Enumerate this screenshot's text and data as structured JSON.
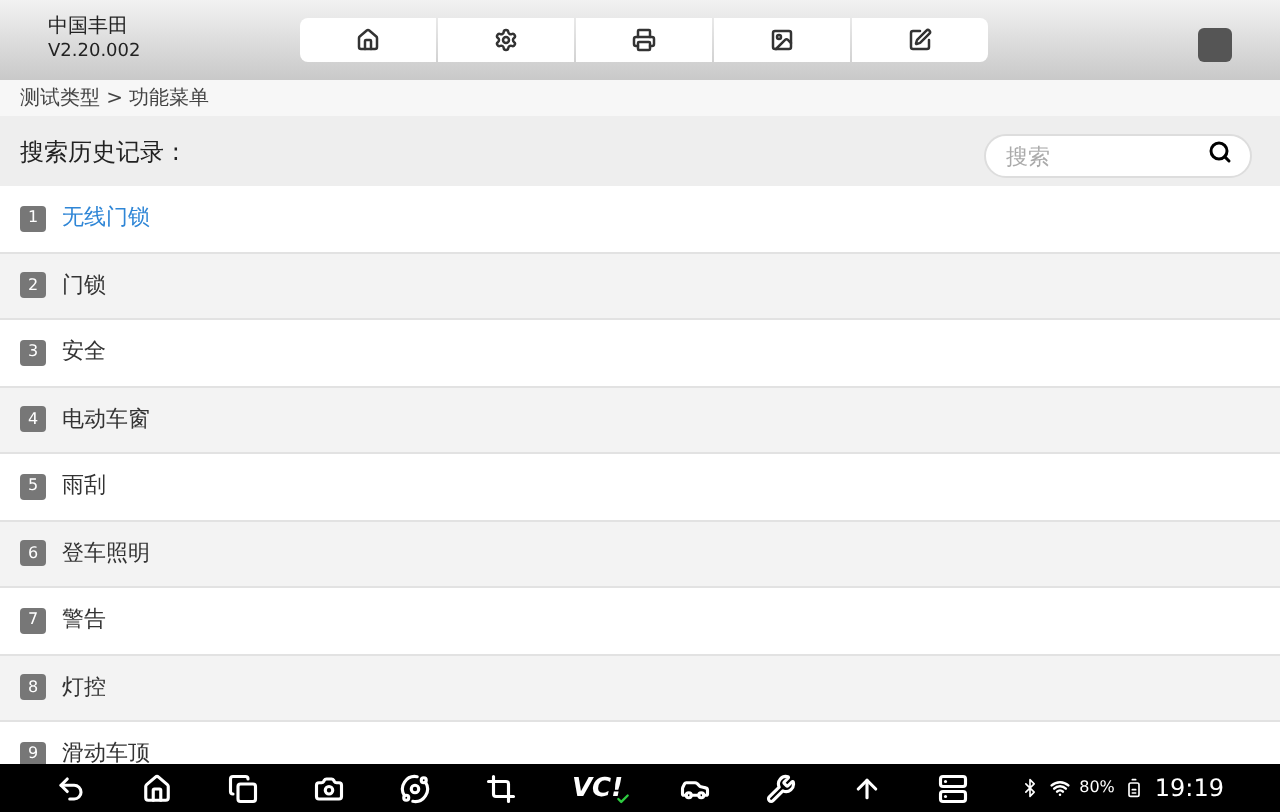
{
  "header": {
    "brand": "中国丰田",
    "version": "V2.20.002"
  },
  "toolbar": [
    {
      "kind": "home"
    },
    {
      "kind": "settings"
    },
    {
      "kind": "print"
    },
    {
      "kind": "image"
    },
    {
      "kind": "edit"
    }
  ],
  "breadcrumb": "测试类型 > 功能菜单",
  "search": {
    "label": "搜索历史记录 :",
    "placeholder": "搜索"
  },
  "items": [
    {
      "number": "1",
      "label": "无线门锁",
      "selected": true
    },
    {
      "number": "2",
      "label": "门锁",
      "selected": false
    },
    {
      "number": "3",
      "label": "安全",
      "selected": false
    },
    {
      "number": "4",
      "label": "电动车窗",
      "selected": false
    },
    {
      "number": "5",
      "label": "雨刮",
      "selected": false
    },
    {
      "number": "6",
      "label": "登车照明",
      "selected": false
    },
    {
      "number": "7",
      "label": "警告",
      "selected": false
    },
    {
      "number": "8",
      "label": "灯控",
      "selected": false
    },
    {
      "number": "9",
      "label": "滑动车顶",
      "selected": false
    }
  ],
  "navbar": [
    {
      "kind": "back"
    },
    {
      "kind": "home"
    },
    {
      "kind": "recent"
    },
    {
      "kind": "camera"
    },
    {
      "kind": "planet"
    },
    {
      "kind": "crop"
    },
    {
      "kind": "vci",
      "text": "VC!"
    },
    {
      "kind": "car"
    },
    {
      "kind": "tools"
    },
    {
      "kind": "upload"
    },
    {
      "kind": "list"
    }
  ],
  "status": {
    "battery": "80%",
    "time": "19:19"
  }
}
